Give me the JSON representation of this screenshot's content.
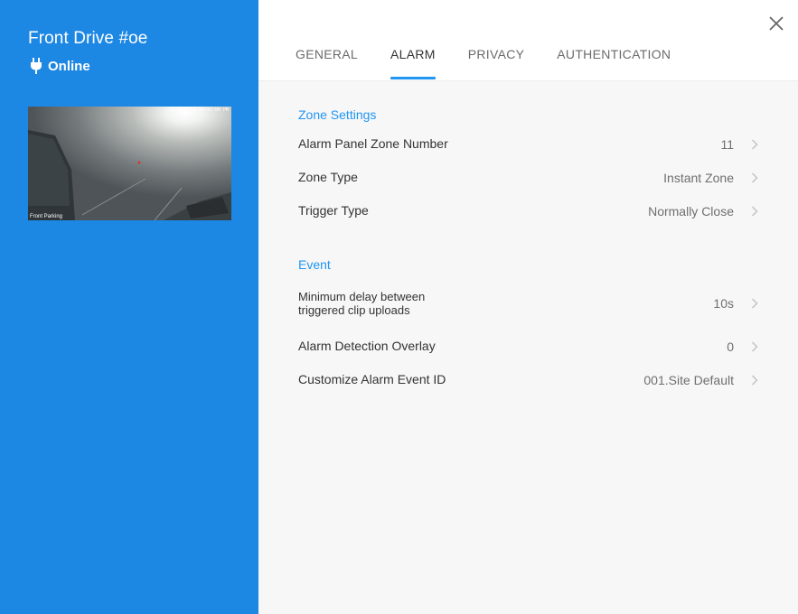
{
  "camera": {
    "title": "Front Drive #oe",
    "status": "Online",
    "thumbnail": {
      "timestamp": "11-10-2018 04:41:00 PM",
      "location_label": "Front Parking"
    }
  },
  "tabs": [
    {
      "label": "GENERAL",
      "active": false
    },
    {
      "label": "ALARM",
      "active": true
    },
    {
      "label": "PRIVACY",
      "active": false
    },
    {
      "label": "AUTHENTICATION",
      "active": false
    }
  ],
  "sections": {
    "zone": {
      "title": "Zone Settings",
      "rows": [
        {
          "label": "Alarm Panel Zone Number",
          "value": "11"
        },
        {
          "label": "Zone Type",
          "value": "Instant Zone"
        },
        {
          "label": "Trigger Type",
          "value": "Normally Close"
        }
      ]
    },
    "event": {
      "title": "Event",
      "rows": [
        {
          "label_line1": "Minimum delay between",
          "label_line2": "triggered clip uploads",
          "value": "10s"
        },
        {
          "label": "Alarm Detection Overlay",
          "value": "0"
        },
        {
          "label": "Customize Alarm Event ID",
          "value": "001.Site Default"
        }
      ]
    }
  },
  "colors": {
    "sidebar": "#1d87e4",
    "accent": "#2196f3"
  },
  "icons": {
    "status": "plug-icon",
    "close": "close-icon",
    "row_chevron": "chevron-right-icon"
  }
}
